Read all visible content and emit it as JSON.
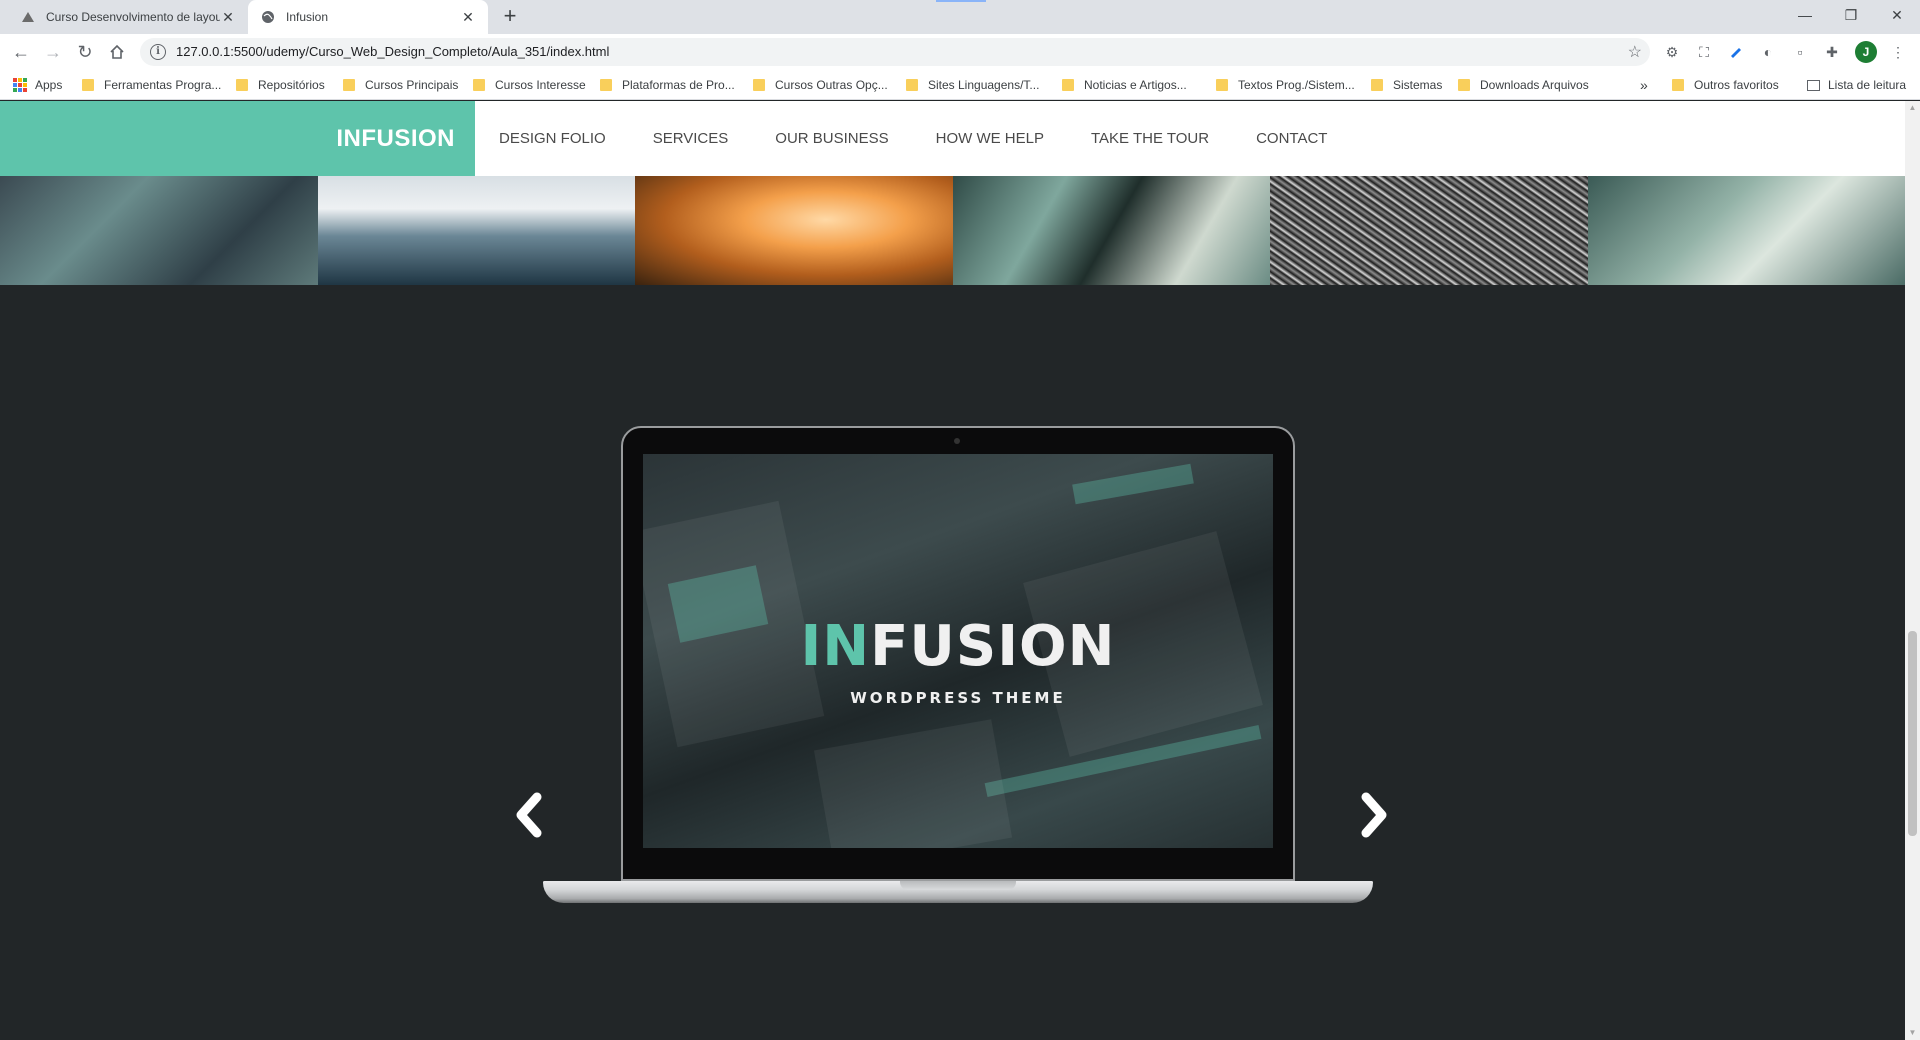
{
  "browser": {
    "tabs": [
      {
        "title": "Curso Desenvolvimento de layou",
        "active": false
      },
      {
        "title": "Infusion",
        "active": true
      }
    ],
    "url": "127.0.0.1:5500/udemy/Curso_Web_Design_Completo/Aula_351/index.html",
    "profile_initial": "J",
    "bookmarks": [
      {
        "label": "Apps",
        "icon": "apps-grid-icon"
      },
      {
        "label": "Ferramentas Progra...",
        "icon": "folder-icon"
      },
      {
        "label": "Repositórios",
        "icon": "folder-icon"
      },
      {
        "label": "Cursos Principais",
        "icon": "folder-icon"
      },
      {
        "label": "Cursos Interesse",
        "icon": "folder-icon"
      },
      {
        "label": "Plataformas de Pro...",
        "icon": "folder-icon"
      },
      {
        "label": "Cursos Outras Opç...",
        "icon": "folder-icon"
      },
      {
        "label": "Sites Linguagens/T...",
        "icon": "folder-icon"
      },
      {
        "label": "Noticias e Artigos...",
        "icon": "folder-icon"
      },
      {
        "label": "Textos Prog./Sistem...",
        "icon": "folder-icon"
      },
      {
        "label": "Sistemas",
        "icon": "folder-icon"
      },
      {
        "label": "Downloads Arquivos",
        "icon": "folder-icon"
      }
    ],
    "bookmarks_overflow": "»",
    "other_bookmarks": "Outros favoritos",
    "reading_list": "Lista de leitura"
  },
  "site": {
    "logo": "INFUSION",
    "nav": [
      "DESIGN FOLIO",
      "SERVICES",
      "OUR BUSINESS",
      "HOW WE HELP",
      "TAKE THE TOUR",
      "CONTACT"
    ],
    "slider": {
      "brand_prefix": "IN",
      "brand_suffix": "FUSION",
      "tagline": "WORDPRESS THEME"
    }
  },
  "colors": {
    "accent": "#5ec4ab",
    "page_background": "#222628",
    "header_background": "#ffffff"
  }
}
